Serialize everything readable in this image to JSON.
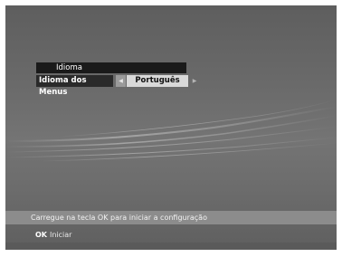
{
  "menu": {
    "title": "Idioma",
    "setting_label": "Idioma dos Menus",
    "setting_value": "Português",
    "left_arrow_icon": "triangle-left-icon",
    "right_arrow_icon": "triangle-right-icon"
  },
  "footer": {
    "help_text": "Carregue na tecla OK para iniciar a configuração",
    "ok_key": "OK",
    "ok_action": "Iniciar"
  }
}
